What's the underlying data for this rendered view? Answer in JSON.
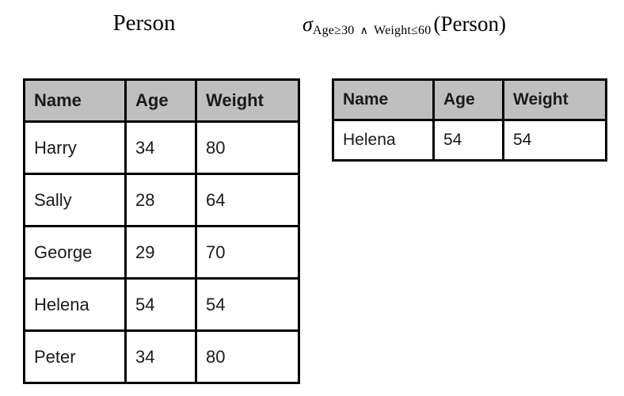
{
  "left_panel": {
    "caption": "Person",
    "table": {
      "columns": [
        "Name",
        "Age",
        "Weight"
      ],
      "rows": [
        [
          "Harry",
          "34",
          "80"
        ],
        [
          "Sally",
          "28",
          "64"
        ],
        [
          "George",
          "29",
          "70"
        ],
        [
          "Helena",
          "54",
          "54"
        ],
        [
          "Peter",
          "34",
          "80"
        ]
      ]
    }
  },
  "right_panel": {
    "caption": {
      "operator_symbol": "σ",
      "condition_left": "Age≥30",
      "conjunction": "∧",
      "condition_right": "Weight≤60",
      "argument": "(Person)",
      "full_text": "σ Age≥30 ∧ Weight≤60 (Person)"
    },
    "table": {
      "columns": [
        "Name",
        "Age",
        "Weight"
      ],
      "rows": [
        [
          "Helena",
          "54",
          "54"
        ]
      ]
    }
  },
  "style": {
    "header_background": "#bfbfbf",
    "border_color": "#000000",
    "cell_background": "#ffffff",
    "text_color": "#1a1a1a",
    "page_background": "#ffffff"
  }
}
